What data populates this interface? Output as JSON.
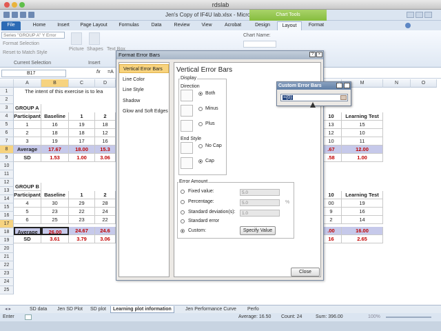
{
  "mac": {
    "title": "rdslab"
  },
  "excel": {
    "title": "Jen's Copy of IF4U lab.xlsx - Microsoft Excel",
    "chart_tools": "Chart Tools"
  },
  "tabs": [
    "File",
    "Home",
    "Insert",
    "Page Layout",
    "Formulas",
    "Data",
    "Review",
    "View",
    "Acrobat",
    "Design",
    "Layout",
    "Format"
  ],
  "ribbon": {
    "selection_box": "Series \"GROUP A\" Y Error",
    "format_selection": "Format Selection",
    "reset": "Reset to Match Style",
    "current_selection": "Current Selection",
    "picture": "Picture",
    "shapes": "Shapes",
    "text_box": "Text Box",
    "insert": "Insert",
    "chart_name_label": "Chart Name:"
  },
  "formula": {
    "name_box": "B17",
    "fx": "fx",
    "content": "=A"
  },
  "columns": [
    "A",
    "B",
    "C",
    "D",
    "",
    "",
    "",
    "",
    "",
    "",
    "",
    "M",
    "N",
    "O"
  ],
  "rows": [
    "1",
    "2",
    "3",
    "4",
    "5",
    "6",
    "7",
    "8",
    "9",
    "10",
    "11",
    "12",
    "13",
    "14",
    "15",
    "16",
    "17",
    "18",
    "19",
    "20",
    "21",
    "22",
    "23",
    "24",
    "25"
  ],
  "sheet": {
    "row1": "The intent of this exercise is to lea",
    "group_a": "GROUP A",
    "group_b": "GROUP B",
    "header": [
      "Participant",
      "Baseline",
      "1",
      "2"
    ],
    "right_header": [
      "10",
      "Learning Test"
    ],
    "a_rows": [
      [
        "1",
        "16",
        "19",
        "18"
      ],
      [
        "2",
        "18",
        "18",
        "12"
      ],
      [
        "3",
        "19",
        "17",
        "16"
      ]
    ],
    "a_right": [
      [
        "13",
        "15"
      ],
      [
        "12",
        "10"
      ],
      [
        "10",
        "11"
      ]
    ],
    "a_avg": [
      "Average",
      "17.67",
      "18.00",
      "15.3"
    ],
    "a_avg_right": [
      ".67",
      "12.00"
    ],
    "a_sd": [
      "SD",
      "1.53",
      "1.00",
      "3.06"
    ],
    "a_sd_right": [
      ".58",
      "1.00"
    ],
    "b_rows": [
      [
        "4",
        "30",
        "29",
        "28"
      ],
      [
        "5",
        "23",
        "22",
        "24"
      ],
      [
        "6",
        "25",
        "23",
        "22"
      ]
    ],
    "b_right": [
      [
        "00",
        "19"
      ],
      [
        "9",
        "16"
      ],
      [
        "2",
        "14"
      ]
    ],
    "b_avg": [
      "Average",
      "26.00",
      "24.67",
      "24.6"
    ],
    "b_avg_right": [
      ".00",
      "16.00"
    ],
    "b_sd": [
      "SD",
      "3.61",
      "3.79",
      "3.06"
    ],
    "b_sd_right": [
      "16",
      "2.65"
    ]
  },
  "sheet_tabs": [
    "SD data",
    "Jen SD Plot",
    "SD plot",
    "Learning plot information",
    "Jen Performance Curve",
    "Perfo"
  ],
  "status": {
    "mode": "Enter",
    "average": "Average: 16.50",
    "count": "Count: 24",
    "sum": "Sum: 396.00",
    "zoom": "100%"
  },
  "format_dialog": {
    "title": "Format Error Bars",
    "nav": [
      "Vertical Error Bars",
      "Line Color",
      "Line Style",
      "Shadow",
      "Glow and Soft Edges"
    ],
    "pane_title": "Vertical Error Bars",
    "display": "Display",
    "direction": "Direction",
    "both": "Both",
    "minus": "Minus",
    "plus": "Plus",
    "end_style": "End Style",
    "no_cap": "No Cap",
    "cap": "Cap",
    "error_amount": "Error Amount",
    "fixed": "Fixed value:",
    "fixed_val": "5.0",
    "percentage": "Percentage:",
    "percentage_val": "5.0",
    "percent_sign": "%",
    "stddev": "Standard deviation(s):",
    "stddev_val": "1.0",
    "stderr": "Standard error",
    "custom": "Custom:",
    "specify": "Specify Value",
    "close": "Close"
  },
  "custom_dialog": {
    "title": "Custom Error Bars",
    "value": "={0}"
  }
}
